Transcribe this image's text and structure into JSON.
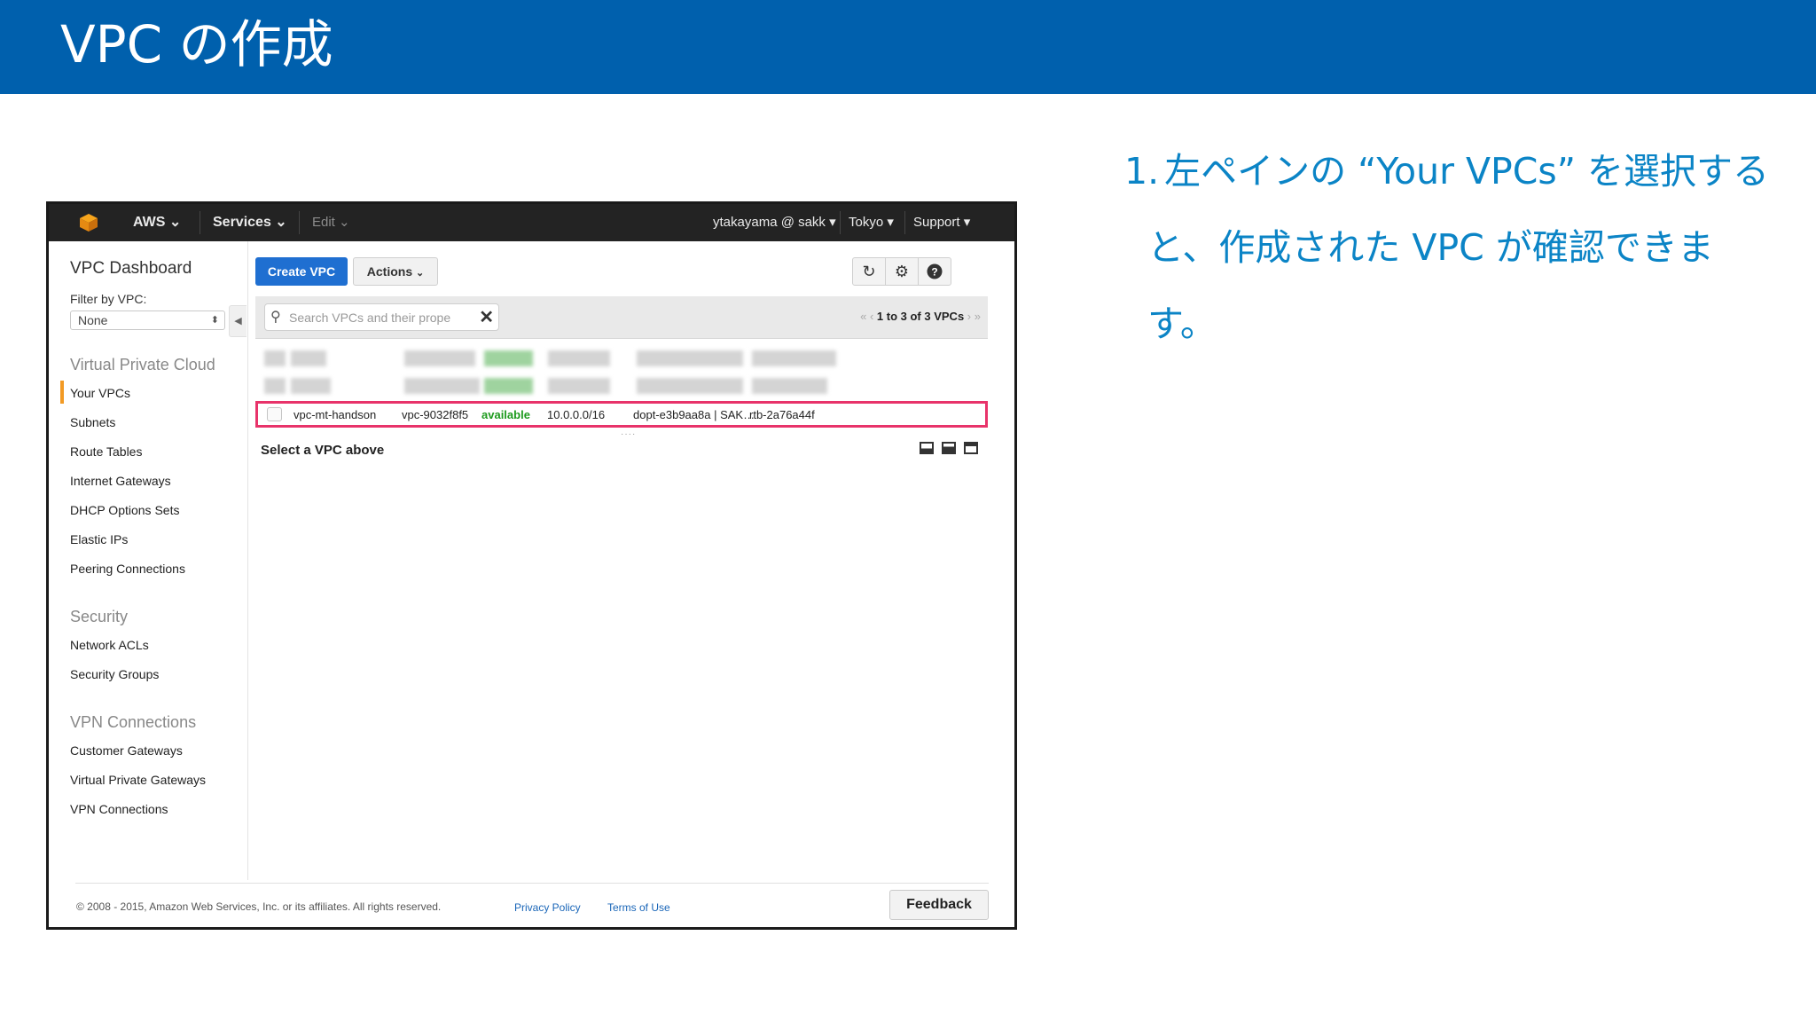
{
  "slide": {
    "title": "VPC の作成",
    "instruction_number": "1.",
    "instruction_line1": "左ペインの “Your VPCs” を選択する",
    "instruction_line2": "と、作成された VPC が確認できま",
    "instruction_line3": "す。"
  },
  "topbar": {
    "brand": "AWS",
    "services": "Services",
    "edit": "Edit",
    "user": "ytakayama @ sakk",
    "region": "Tokyo",
    "support": "Support"
  },
  "sidebar": {
    "title": "VPC Dashboard",
    "filter_label": "Filter by VPC:",
    "filter_value": "None",
    "sections": [
      {
        "label": "Virtual Private Cloud",
        "items": [
          "Your VPCs",
          "Subnets",
          "Route Tables",
          "Internet Gateways",
          "DHCP Options Sets",
          "Elastic IPs",
          "Peering Connections"
        ]
      },
      {
        "label": "Security",
        "items": [
          "Network ACLs",
          "Security Groups"
        ]
      },
      {
        "label": "VPN Connections",
        "items": [
          "Customer Gateways",
          "Virtual Private Gateways",
          "VPN Connections"
        ]
      }
    ],
    "active_item": "Your VPCs"
  },
  "toolbar": {
    "create_label": "Create VPC",
    "actions_label": "Actions"
  },
  "search": {
    "placeholder": "Search VPCs and their prope",
    "pager": "1 to 3 of 3 VPCs"
  },
  "table": {
    "highlighted_row": {
      "name": "vpc-mt-handson",
      "vpc_id": "vpc-9032f8f5",
      "state": "available",
      "cidr": "10.0.0.0/16",
      "dhcp": "dopt-e3b9aa8a | SAK…",
      "route_table": "rtb-2a76a44f"
    }
  },
  "details": {
    "title": "Select a VPC above"
  },
  "footer": {
    "copyright": "© 2008 - 2015, Amazon Web Services, Inc. or its affiliates. All rights reserved.",
    "privacy": "Privacy Policy",
    "terms": "Terms of Use",
    "feedback": "Feedback"
  },
  "colors": {
    "header_blue": "#0060ad",
    "instruction_blue": "#0b84c6",
    "primary_button": "#1f6fd1",
    "highlight_border": "#e8336a",
    "status_green": "#1d9a1d",
    "active_marker": "#f29a24"
  }
}
